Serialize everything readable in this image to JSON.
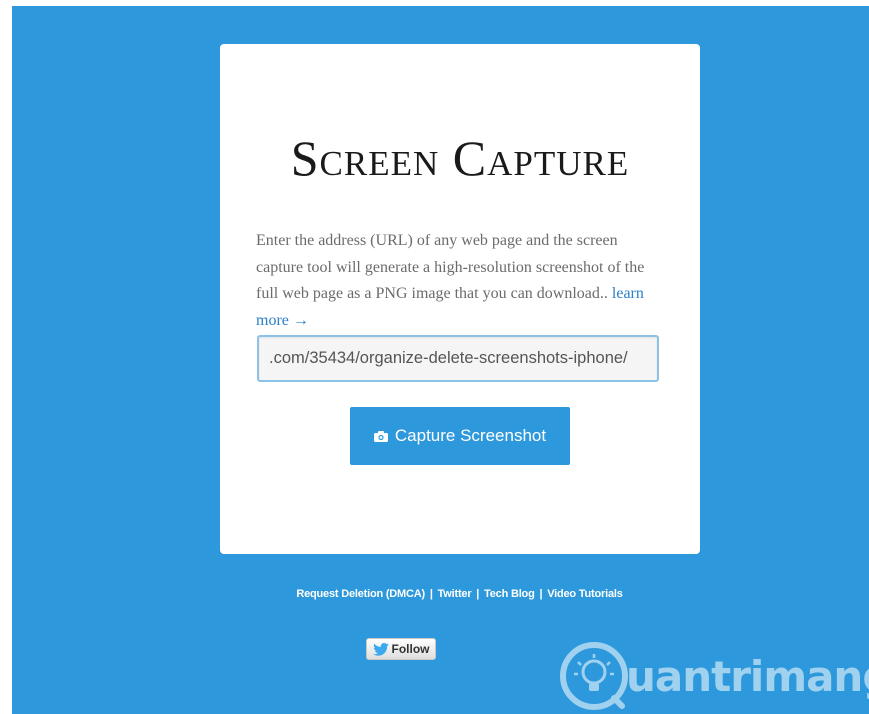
{
  "card": {
    "title": "Screen Capture",
    "description": "Enter the address (URL) of any web page and the screen capture tool will generate a high-resolution screenshot of the full web page as a PNG image that you can download.. ",
    "learn_more": "learn more →",
    "url_value": ".com/35434/organize-delete-screenshots-iphone/",
    "capture_label": "Capture Screenshot"
  },
  "footer": {
    "links": [
      "Request Deletion (DMCA)",
      "Twitter",
      "Tech Blog",
      "Video Tutorials"
    ],
    "separator": "|",
    "follow_label": "Follow"
  },
  "watermark": {
    "text": "uantrimang"
  },
  "icons": {
    "capture": "camera-icon",
    "follow": "twitter-bird-icon",
    "watermark": "lightbulb-icon"
  },
  "colors": {
    "background": "#2d99dc",
    "button": "#2d99dc",
    "link": "#2a7fc7",
    "input_border": "#8cc2ea"
  }
}
